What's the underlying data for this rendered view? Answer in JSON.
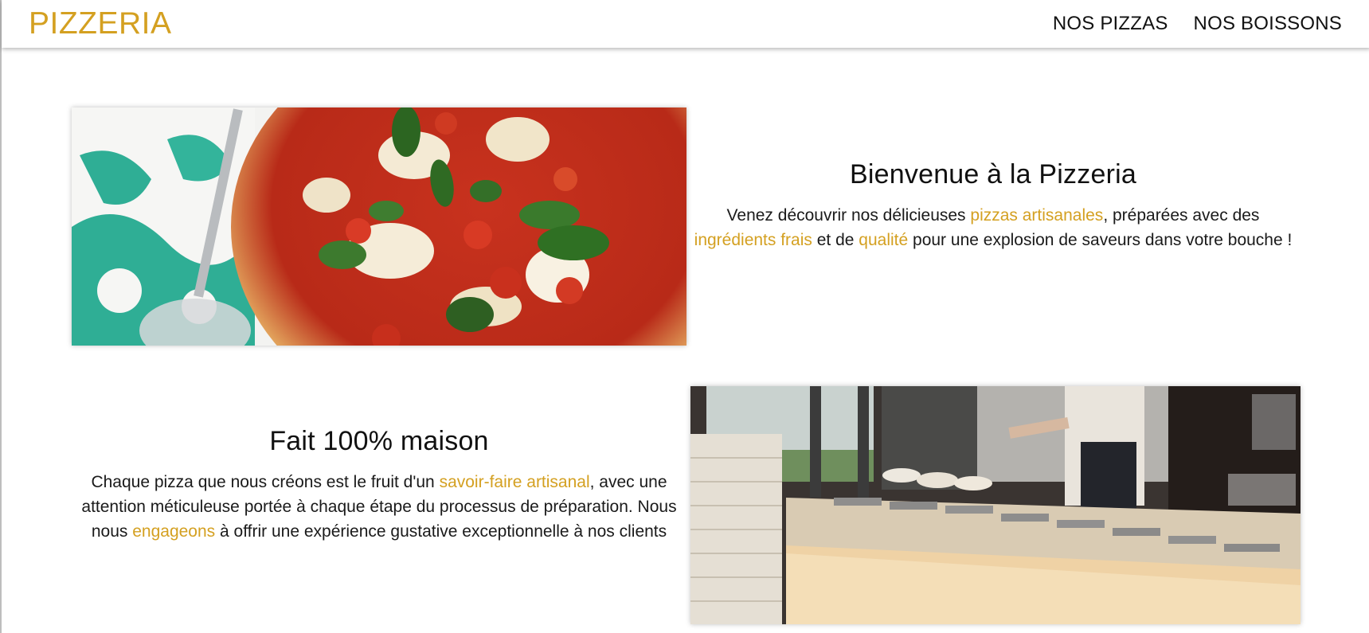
{
  "colors": {
    "accent": "#d4a021",
    "text": "#111111",
    "background": "#ffffff"
  },
  "header": {
    "brand": "PIZZERIA",
    "nav": [
      {
        "label": "NOS PIZZAS"
      },
      {
        "label": "NOS BOISSONS"
      }
    ]
  },
  "section_welcome": {
    "image": "pizza-margherita-photo",
    "title": "Bienvenue à la Pizzeria",
    "text": [
      {
        "t": "Venez découvrir nos délicieuses "
      },
      {
        "t": "pizzas artisanales",
        "hl": true
      },
      {
        "t": ", préparées avec des "
      },
      {
        "t": "ingrédients frais",
        "hl": true
      },
      {
        "t": " et de "
      },
      {
        "t": "qualité",
        "hl": true
      },
      {
        "t": " pour une explosion de saveurs dans votre bouche !"
      }
    ]
  },
  "section_homemade": {
    "image": "pizzeria-kitchen-photo",
    "title": "Fait 100% maison",
    "text": [
      {
        "t": "Chaque pizza que nous créons est le fruit d'un "
      },
      {
        "t": "savoir-faire artisanal",
        "hl": true
      },
      {
        "t": ", avec une attention méticuleuse portée à chaque étape du processus de préparation. Nous nous "
      },
      {
        "t": "engageons",
        "hl": true
      },
      {
        "t": " à offrir une expérience gustative exceptionnelle à nos clients"
      }
    ]
  }
}
